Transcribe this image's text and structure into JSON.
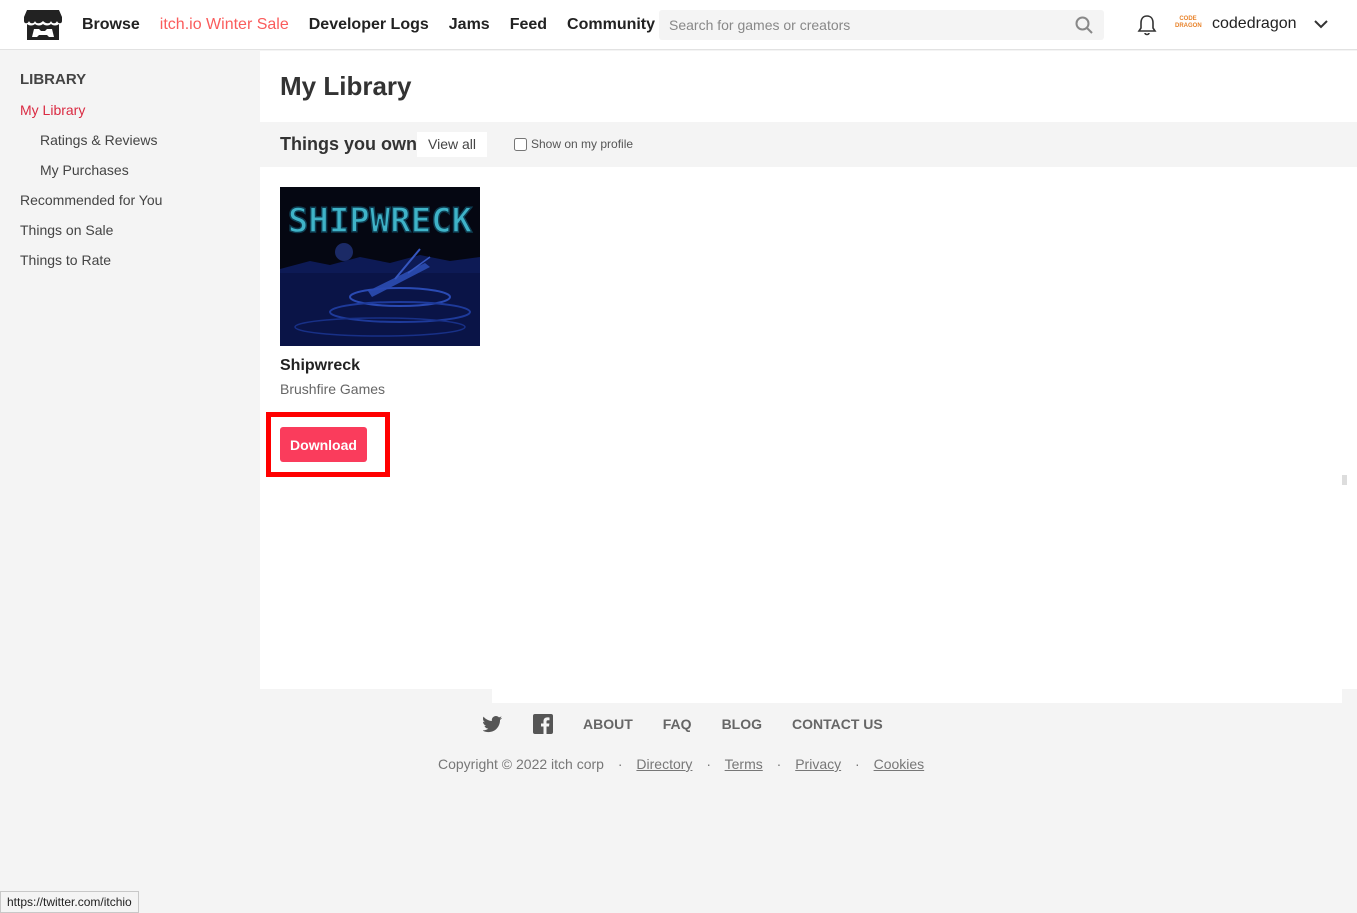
{
  "header": {
    "nav": {
      "browse": "Browse",
      "sale": "itch.io Winter Sale",
      "devlogs": "Developer Logs",
      "jams": "Jams",
      "feed": "Feed",
      "community": "Community"
    },
    "search_placeholder": "Search for games or creators",
    "avatar_text": "CODE DRAGON",
    "username": "codedragon"
  },
  "sidebar": {
    "heading": "LIBRARY",
    "items": [
      "My Library",
      "Ratings & Reviews",
      "My Purchases",
      "Recommended for You",
      "Things on Sale",
      "Things to Rate"
    ]
  },
  "main": {
    "title": "My Library",
    "section_title": "Things you own",
    "view_all": "View all",
    "show_profile": "Show on my profile",
    "games": [
      {
        "cover_title": "SHIPWRECK",
        "title": "Shipwreck",
        "author": "Brushfire Games",
        "action": "Download"
      }
    ]
  },
  "footer": {
    "links": [
      "ABOUT",
      "FAQ",
      "BLOG",
      "CONTACT US"
    ],
    "copyright": "Copyright © 2022 itch corp",
    "legal": [
      "Directory",
      "Terms",
      "Privacy",
      "Cookies"
    ]
  },
  "status_url": "https://twitter.com/itchio",
  "colors": {
    "accent": "#fa5c5c",
    "download": "#fa3c5c",
    "active": "#da2b43",
    "highlight": "#ff0000"
  }
}
